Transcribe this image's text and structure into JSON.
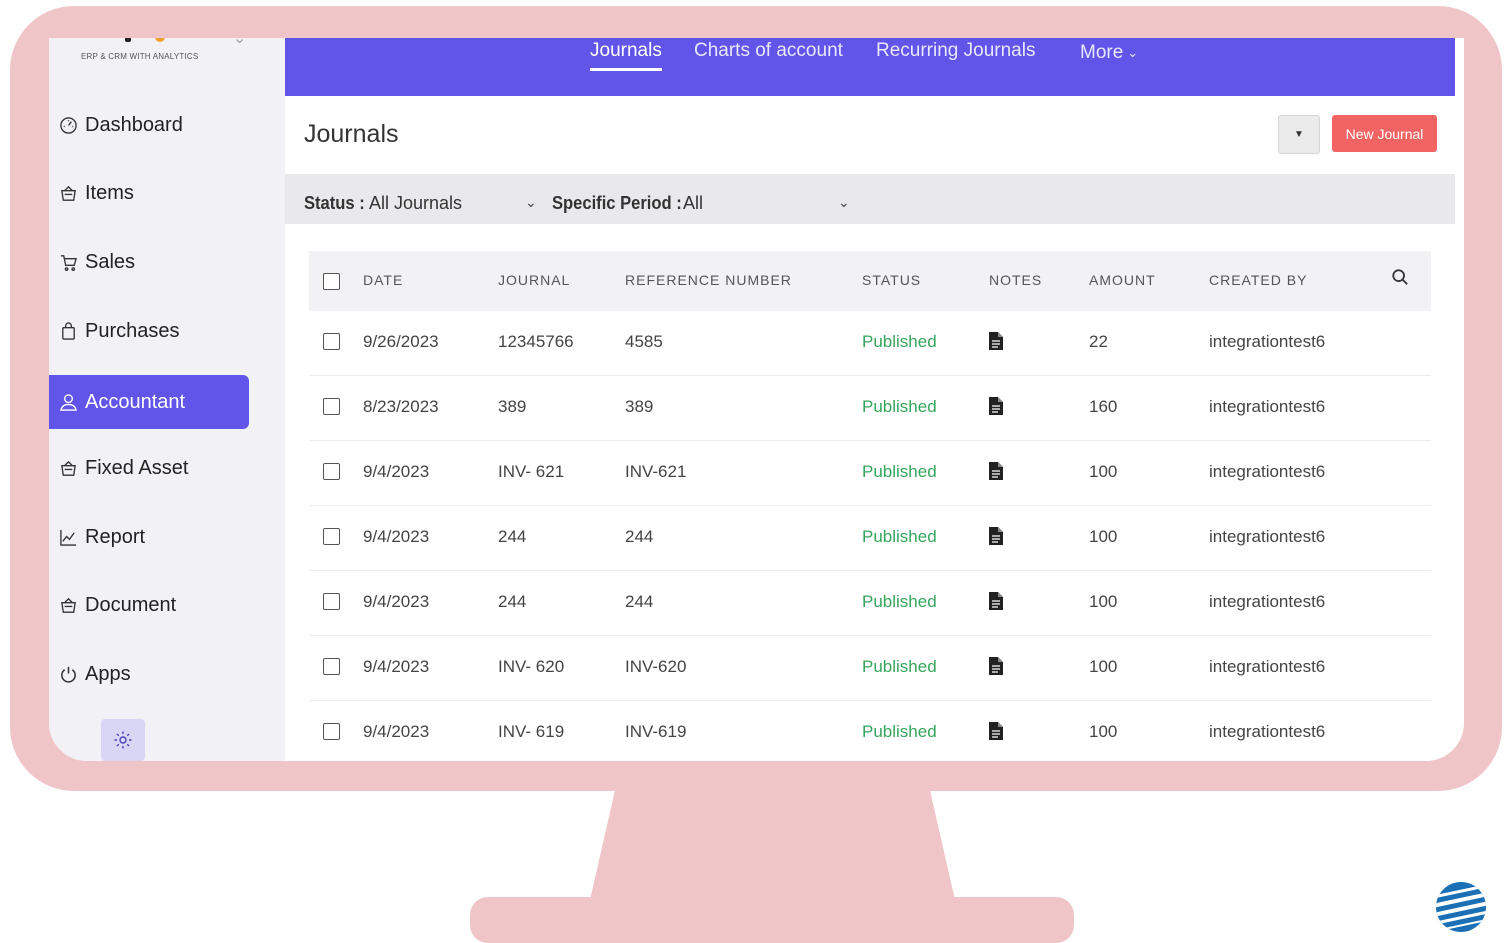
{
  "logo": {
    "tagline": "ERP & CRM WITH ANALYTICS"
  },
  "sidebar": {
    "items": [
      {
        "label": "Dashboard",
        "icon": "dashboard-icon"
      },
      {
        "label": "Items",
        "icon": "basket-icon"
      },
      {
        "label": "Sales",
        "icon": "cart-icon"
      },
      {
        "label": "Purchases",
        "icon": "bag-icon"
      },
      {
        "label": "Accountant",
        "icon": "user-icon",
        "active": true
      },
      {
        "label": "Fixed Asset",
        "icon": "basket-icon"
      },
      {
        "label": "Report",
        "icon": "chart-icon"
      },
      {
        "label": "Document",
        "icon": "basket-icon"
      },
      {
        "label": "Apps",
        "icon": "power-icon"
      }
    ],
    "settings_icon": "gear-icon"
  },
  "topnav": {
    "tabs": [
      {
        "label": "Journals",
        "active": true
      },
      {
        "label": "Charts of account"
      },
      {
        "label": "Recurring Journals"
      },
      {
        "label": "More"
      }
    ]
  },
  "page": {
    "title": "Journals",
    "new_button": "New Journal"
  },
  "filters": {
    "status_label": "Status :",
    "status_value": "All Journals",
    "period_label": "Specific Period :",
    "period_value": "All"
  },
  "table": {
    "columns": [
      "DATE",
      "JOURNAL",
      "REFERENCE NUMBER",
      "STATUS",
      "NOTES",
      "AMOUNT",
      "CREATED BY"
    ],
    "rows": [
      {
        "date": "9/26/2023",
        "journal": "12345766",
        "reference": "4585",
        "status": "Published",
        "amount": "22",
        "created_by": "integrationtest6"
      },
      {
        "date": "8/23/2023",
        "journal": "389",
        "reference": "389",
        "status": "Published",
        "amount": "160",
        "created_by": "integrationtest6"
      },
      {
        "date": "9/4/2023",
        "journal": "INV- 621",
        "reference": "INV-621",
        "status": "Published",
        "amount": "100",
        "created_by": "integrationtest6"
      },
      {
        "date": "9/4/2023",
        "journal": "244",
        "reference": "244",
        "status": "Published",
        "amount": "100",
        "created_by": "integrationtest6"
      },
      {
        "date": "9/4/2023",
        "journal": "244",
        "reference": "244",
        "status": "Published",
        "amount": "100",
        "created_by": "integrationtest6"
      },
      {
        "date": "9/4/2023",
        "journal": "INV- 620",
        "reference": "INV-620",
        "status": "Published",
        "amount": "100",
        "created_by": "integrationtest6"
      },
      {
        "date": "9/4/2023",
        "journal": "INV- 619",
        "reference": "INV-619",
        "status": "Published",
        "amount": "100",
        "created_by": "integrationtest6"
      }
    ]
  },
  "colors": {
    "accent": "#6055e8",
    "primary_button": "#f26463",
    "status_published": "#35a55b",
    "frame": "#efc5c8"
  }
}
